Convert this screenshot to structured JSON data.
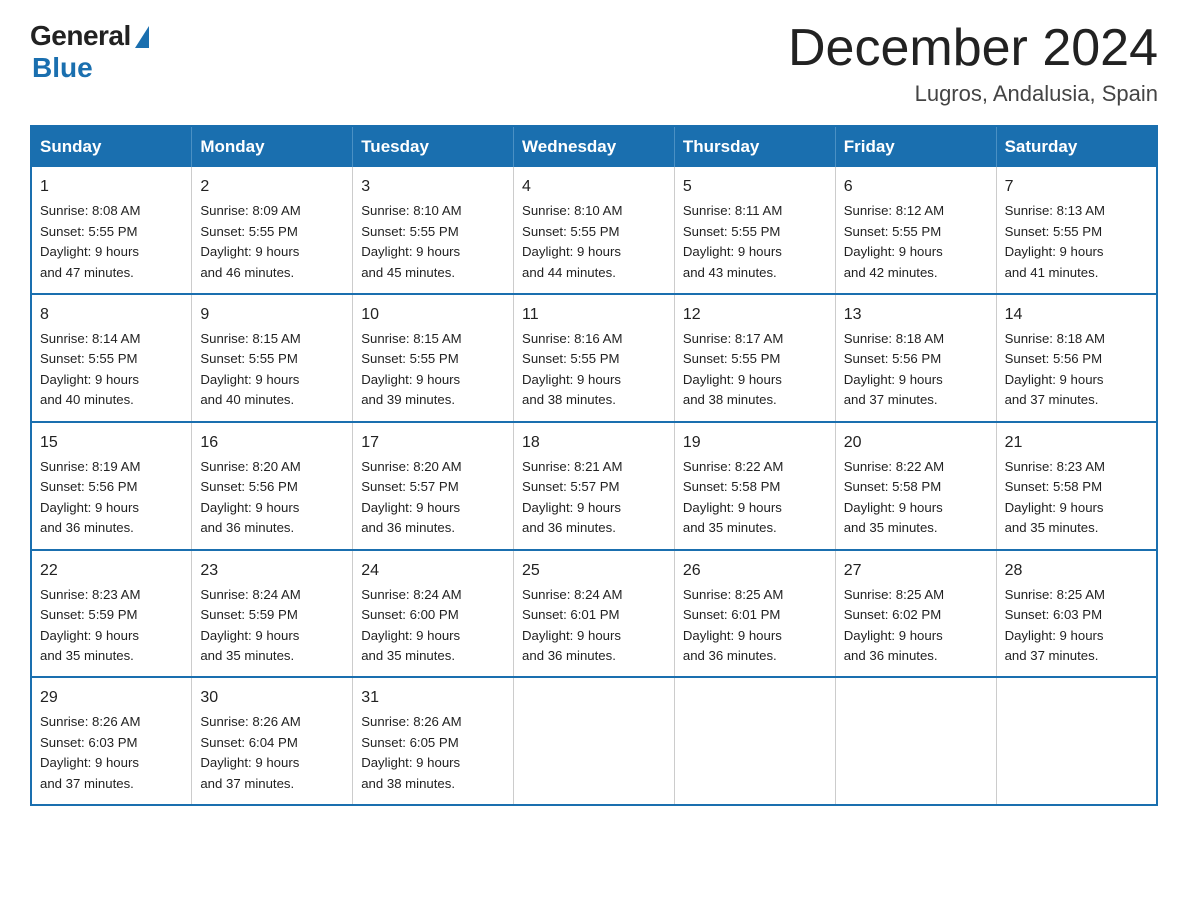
{
  "logo": {
    "general": "General",
    "blue": "Blue"
  },
  "header": {
    "month": "December 2024",
    "location": "Lugros, Andalusia, Spain"
  },
  "days_of_week": [
    "Sunday",
    "Monday",
    "Tuesday",
    "Wednesday",
    "Thursday",
    "Friday",
    "Saturday"
  ],
  "weeks": [
    [
      {
        "num": "1",
        "info": "Sunrise: 8:08 AM\nSunset: 5:55 PM\nDaylight: 9 hours\nand 47 minutes."
      },
      {
        "num": "2",
        "info": "Sunrise: 8:09 AM\nSunset: 5:55 PM\nDaylight: 9 hours\nand 46 minutes."
      },
      {
        "num": "3",
        "info": "Sunrise: 8:10 AM\nSunset: 5:55 PM\nDaylight: 9 hours\nand 45 minutes."
      },
      {
        "num": "4",
        "info": "Sunrise: 8:10 AM\nSunset: 5:55 PM\nDaylight: 9 hours\nand 44 minutes."
      },
      {
        "num": "5",
        "info": "Sunrise: 8:11 AM\nSunset: 5:55 PM\nDaylight: 9 hours\nand 43 minutes."
      },
      {
        "num": "6",
        "info": "Sunrise: 8:12 AM\nSunset: 5:55 PM\nDaylight: 9 hours\nand 42 minutes."
      },
      {
        "num": "7",
        "info": "Sunrise: 8:13 AM\nSunset: 5:55 PM\nDaylight: 9 hours\nand 41 minutes."
      }
    ],
    [
      {
        "num": "8",
        "info": "Sunrise: 8:14 AM\nSunset: 5:55 PM\nDaylight: 9 hours\nand 40 minutes."
      },
      {
        "num": "9",
        "info": "Sunrise: 8:15 AM\nSunset: 5:55 PM\nDaylight: 9 hours\nand 40 minutes."
      },
      {
        "num": "10",
        "info": "Sunrise: 8:15 AM\nSunset: 5:55 PM\nDaylight: 9 hours\nand 39 minutes."
      },
      {
        "num": "11",
        "info": "Sunrise: 8:16 AM\nSunset: 5:55 PM\nDaylight: 9 hours\nand 38 minutes."
      },
      {
        "num": "12",
        "info": "Sunrise: 8:17 AM\nSunset: 5:55 PM\nDaylight: 9 hours\nand 38 minutes."
      },
      {
        "num": "13",
        "info": "Sunrise: 8:18 AM\nSunset: 5:56 PM\nDaylight: 9 hours\nand 37 minutes."
      },
      {
        "num": "14",
        "info": "Sunrise: 8:18 AM\nSunset: 5:56 PM\nDaylight: 9 hours\nand 37 minutes."
      }
    ],
    [
      {
        "num": "15",
        "info": "Sunrise: 8:19 AM\nSunset: 5:56 PM\nDaylight: 9 hours\nand 36 minutes."
      },
      {
        "num": "16",
        "info": "Sunrise: 8:20 AM\nSunset: 5:56 PM\nDaylight: 9 hours\nand 36 minutes."
      },
      {
        "num": "17",
        "info": "Sunrise: 8:20 AM\nSunset: 5:57 PM\nDaylight: 9 hours\nand 36 minutes."
      },
      {
        "num": "18",
        "info": "Sunrise: 8:21 AM\nSunset: 5:57 PM\nDaylight: 9 hours\nand 36 minutes."
      },
      {
        "num": "19",
        "info": "Sunrise: 8:22 AM\nSunset: 5:58 PM\nDaylight: 9 hours\nand 35 minutes."
      },
      {
        "num": "20",
        "info": "Sunrise: 8:22 AM\nSunset: 5:58 PM\nDaylight: 9 hours\nand 35 minutes."
      },
      {
        "num": "21",
        "info": "Sunrise: 8:23 AM\nSunset: 5:58 PM\nDaylight: 9 hours\nand 35 minutes."
      }
    ],
    [
      {
        "num": "22",
        "info": "Sunrise: 8:23 AM\nSunset: 5:59 PM\nDaylight: 9 hours\nand 35 minutes."
      },
      {
        "num": "23",
        "info": "Sunrise: 8:24 AM\nSunset: 5:59 PM\nDaylight: 9 hours\nand 35 minutes."
      },
      {
        "num": "24",
        "info": "Sunrise: 8:24 AM\nSunset: 6:00 PM\nDaylight: 9 hours\nand 35 minutes."
      },
      {
        "num": "25",
        "info": "Sunrise: 8:24 AM\nSunset: 6:01 PM\nDaylight: 9 hours\nand 36 minutes."
      },
      {
        "num": "26",
        "info": "Sunrise: 8:25 AM\nSunset: 6:01 PM\nDaylight: 9 hours\nand 36 minutes."
      },
      {
        "num": "27",
        "info": "Sunrise: 8:25 AM\nSunset: 6:02 PM\nDaylight: 9 hours\nand 36 minutes."
      },
      {
        "num": "28",
        "info": "Sunrise: 8:25 AM\nSunset: 6:03 PM\nDaylight: 9 hours\nand 37 minutes."
      }
    ],
    [
      {
        "num": "29",
        "info": "Sunrise: 8:26 AM\nSunset: 6:03 PM\nDaylight: 9 hours\nand 37 minutes."
      },
      {
        "num": "30",
        "info": "Sunrise: 8:26 AM\nSunset: 6:04 PM\nDaylight: 9 hours\nand 37 minutes."
      },
      {
        "num": "31",
        "info": "Sunrise: 8:26 AM\nSunset: 6:05 PM\nDaylight: 9 hours\nand 38 minutes."
      },
      null,
      null,
      null,
      null
    ]
  ]
}
